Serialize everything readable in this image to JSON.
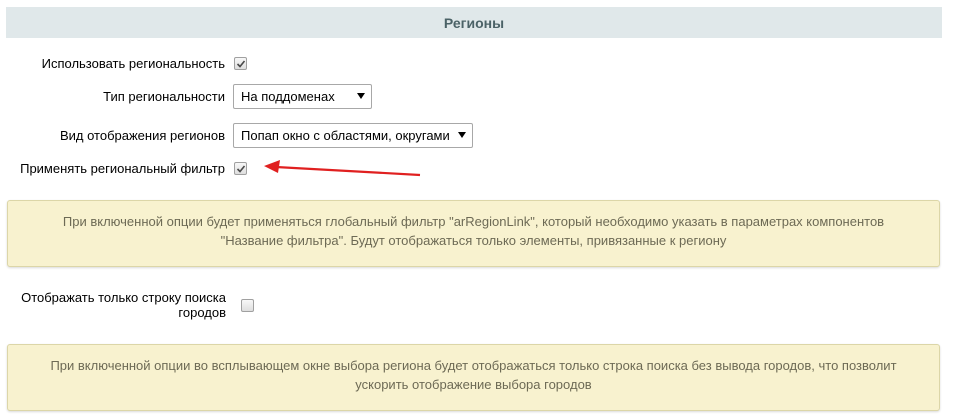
{
  "section": {
    "title": "Регионы"
  },
  "settings": {
    "use_regionality": {
      "label": "Использовать региональность",
      "checked": true
    },
    "regionality_type": {
      "label": "Тип региональности",
      "value": "На поддоменах"
    },
    "regions_display": {
      "label": "Вид отображения регионов",
      "value": "Попап окно с областями, округами"
    },
    "apply_region_filter": {
      "label": "Применять региональный фильтр",
      "checked": true
    },
    "search_only": {
      "label_line1": "Отображать только строку поиска",
      "label_line2": "городов",
      "checked": false
    }
  },
  "notes": {
    "filter_note_line1": "При включенной опции будет применяться глобальный фильтр \"arRegionLink\", который необходимо указать в параметрах компонентов",
    "filter_note_line2": "\"Название фильтра\". Будут отображаться только элементы, привязанные к региону",
    "search_note_line1": "При включенной опции во всплывающем окне выбора региона будет отображаться только строка поиска без вывода городов, что позволит",
    "search_note_line2": "ускорить отображение выбора городов"
  },
  "colors": {
    "header_bg": "#e0e8ea",
    "header_text": "#4b6267",
    "note_bg": "#f8f2cf",
    "note_text": "#6d6a55",
    "annotation_arrow": "#e02020"
  }
}
